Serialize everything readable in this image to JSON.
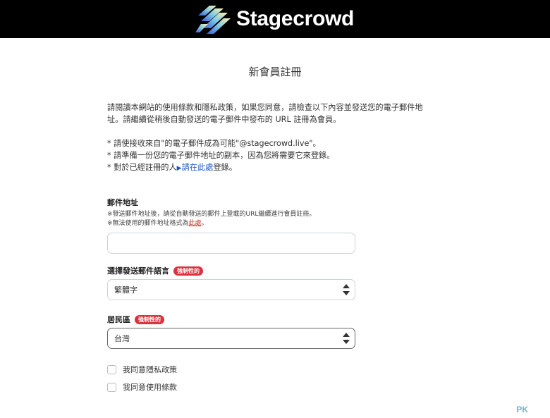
{
  "header": {
    "brand": "Stagecrowd"
  },
  "page_title": "新會員註冊",
  "intro": {
    "line1": "請閱讀本網站的使用條款和隱私政策，如果您同意，請檢查以下內容並發送您的電子郵件地",
    "line2": "址。請繼續從稍後自動發送的電子郵件中發布的 URL 註冊為會員。",
    "bullet1": "* 請使接收來自\"的電子郵件成為可能\"@stagecrowd.live\"。",
    "bullet2": "* 請準備一份您的電子郵件地址的副本，因為您將需要它來登錄。",
    "bullet3_prefix": "* 對於已經註冊的人",
    "bullet3_link": "請在此處",
    "bullet3_suffix": "登錄。"
  },
  "email": {
    "label": "郵件地址",
    "note1": "※發送郵件地址後，請從自動發送的郵件上登載的URL繼續進行會員註冊。",
    "note2_prefix": "※無法使用的郵件地址格式為",
    "note2_link": "此處",
    "note2_suffix": "。",
    "value": ""
  },
  "language": {
    "label": "選擇發送郵件語言",
    "badge": "強制性的",
    "selected": "繁體字"
  },
  "region": {
    "label": "居民區",
    "badge": "強制性的",
    "selected": "台灣"
  },
  "checkboxes": [
    {
      "label": "我同意隱私政策",
      "checked": false
    },
    {
      "label": "我同意使用條款",
      "checked": false
    }
  ],
  "watermark": "PK",
  "colors": {
    "header_bg": "#000000",
    "badge": "#d9333f",
    "link": "#1a55c7"
  }
}
